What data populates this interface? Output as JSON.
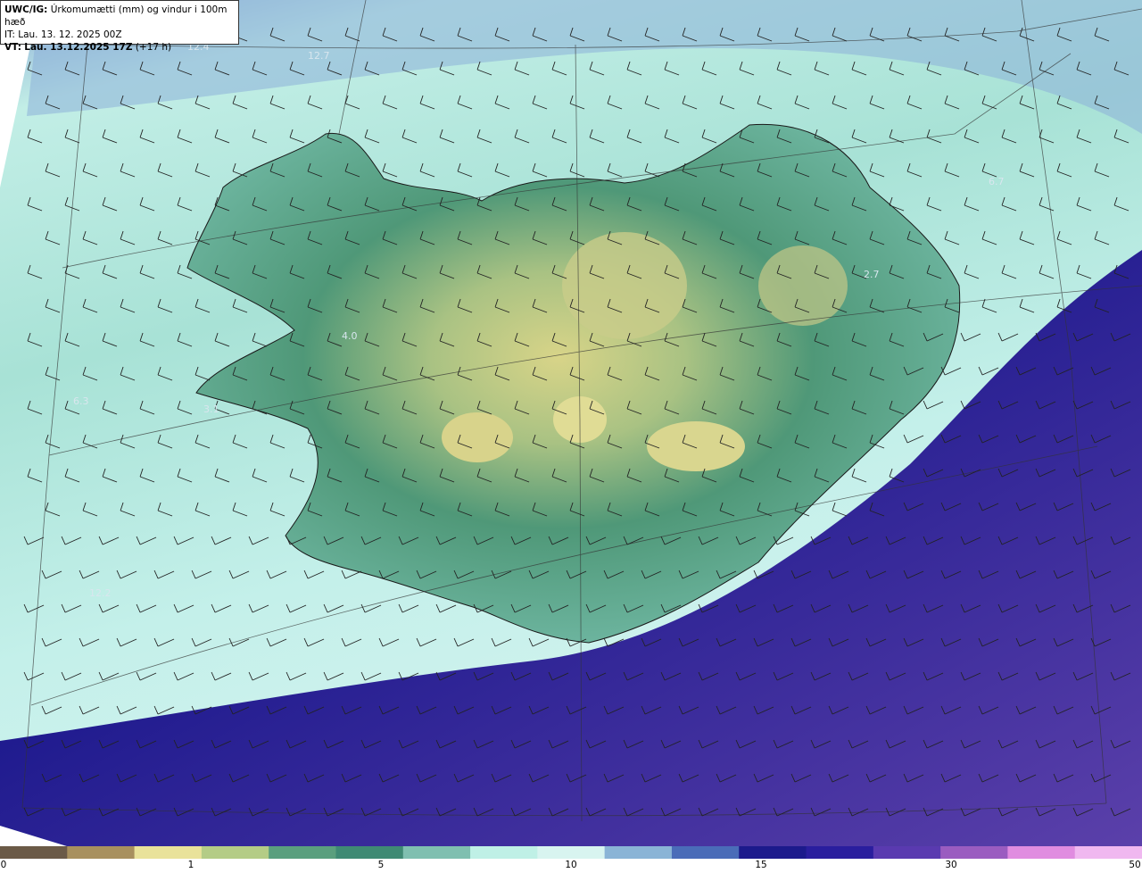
{
  "header": {
    "model": "UWC/IG:",
    "field": "Úrkomumætti (mm) og vindur i 100m hæð",
    "init_time": "IT: Lau. 13. 12. 2025 00Z",
    "valid_prefix": "VT:",
    "valid_time": "Lau. 13.12.2025 17Z",
    "lead": "(+17 h)"
  },
  "map_labels": [
    {
      "id": "label-12-4",
      "text": "12.4"
    },
    {
      "id": "label-12-7",
      "text": "12.7"
    },
    {
      "id": "label-6-7",
      "text": "6.7"
    },
    {
      "id": "label-4-0",
      "text": "4.0"
    },
    {
      "id": "label-6-3",
      "text": "6.3"
    },
    {
      "id": "label-3-1",
      "text": "3.1"
    },
    {
      "id": "label-2-7",
      "text": "2.7"
    },
    {
      "id": "label-12-2",
      "text": "12.2"
    }
  ],
  "colorbar": {
    "ticks": [
      "0",
      "1",
      "5",
      "10",
      "15",
      "30",
      "50"
    ],
    "colors": [
      "#6b5a47",
      "#a8905e",
      "#e9e29a",
      "#b4cc86",
      "#5a9f7e",
      "#3f8a74",
      "#7fbfb0",
      "#bff0e6",
      "#d8f4f0",
      "#8ab4d6",
      "#4a6cb8",
      "#1c1a8c",
      "#2a1e9e",
      "#5a3ab0",
      "#9a5cc0",
      "#e08ce0",
      "#f0b8f0"
    ]
  },
  "colors": {
    "land_mid": "#4e9a78",
    "highland": "#d8d488",
    "coast_sea": "#bfece4",
    "heavy": "#1f1a8e",
    "purple": "#5b3fa8"
  }
}
